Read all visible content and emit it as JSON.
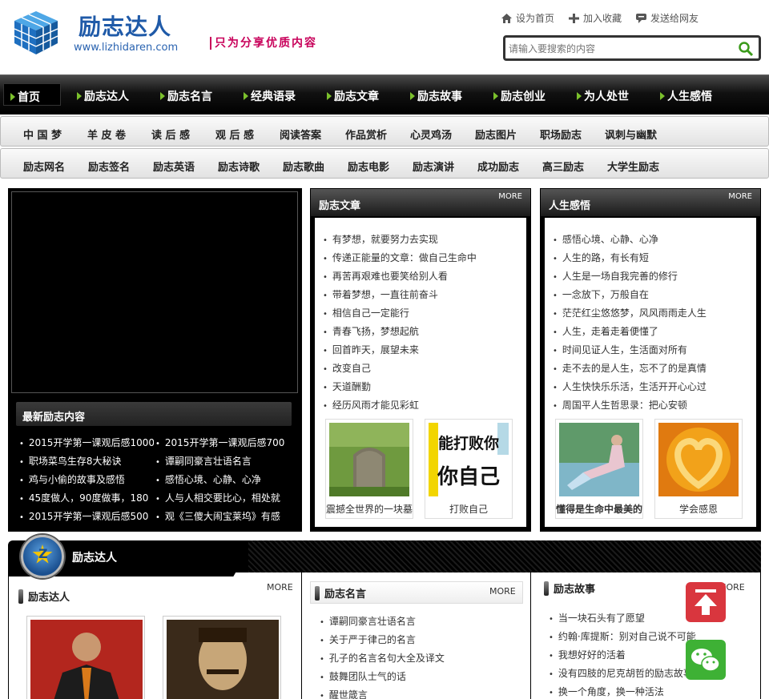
{
  "header": {
    "logo_title": "励志达人",
    "logo_url": "www.lizhidaren.com",
    "slogan": "只为分享优质内容",
    "toplinks": [
      {
        "label": "设为首页",
        "icon": "home-icon"
      },
      {
        "label": "加入收藏",
        "icon": "plus-icon"
      },
      {
        "label": "发送给网友",
        "icon": "chat-icon"
      }
    ],
    "search_placeholder": "请输入要搜索的内容"
  },
  "nav": {
    "home": "首页",
    "items": [
      "励志达人",
      "励志名言",
      "经典语录",
      "励志文章",
      "励志故事",
      "励志创业",
      "为人处世",
      "人生感悟"
    ]
  },
  "subnav1": [
    "中 国 梦",
    "羊 皮 卷",
    "读 后 感",
    "观 后 感",
    "阅读答案",
    "作品赏析",
    "心灵鸡汤",
    "励志图片",
    "职场励志",
    "讽刺与幽默"
  ],
  "subnav2": [
    "励志网名",
    "励志签名",
    "励志英语",
    "励志诗歌",
    "励志歌曲",
    "励志电影",
    "励志演讲",
    "成功励志",
    "高三励志",
    "大学生励志"
  ],
  "latest": {
    "title": "最新励志内容",
    "items": [
      "2015开学第一课观后感1000",
      "2015开学第一课观后感700",
      "职场菜鸟生存8大秘诀",
      "谭嗣同豪言壮语名言",
      "鸡与小偷的故事及感悟",
      "感悟心境、心静、心净",
      "45度做人，90度做事，180",
      "人与人相交要比心，相处就",
      "2015开学第一课观后感500",
      "观《三傻大闹宝莱坞》有感"
    ]
  },
  "articles": {
    "title": "励志文章",
    "more": "MORE",
    "items": [
      "有梦想，就要努力去实现",
      "传递正能量的文章：做自己生命中",
      "再苦再艰难也要笑给别人看",
      "带着梦想，一直往前奋斗",
      "相信自己一定能行",
      "青春飞扬，梦想起航",
      "回首昨天，展望未来",
      "改变自己",
      "天道酬勤",
      "经历风雨才能见彩虹"
    ],
    "thumbs": [
      {
        "caption": "震撼全世界的一块墓"
      },
      {
        "caption": "打败自己",
        "img_text": "能打败你 你自己"
      }
    ]
  },
  "life": {
    "title": "人生感悟",
    "more": "MORE",
    "items": [
      "感悟心境、心静、心净",
      "人生的路，有长有短",
      "人生是一场自我完善的修行",
      "一念放下，万般自在",
      "茫茫红尘悠悠梦，风风雨雨走人生",
      "人生，走着走着便懂了",
      "时间见证人生，生活面对所有",
      "走不去的是人生，忘不了的是真情",
      "人生快快乐乐活，生活开开心心过",
      "周国平人生哲思录：把心安顿"
    ],
    "thumbs": [
      {
        "caption": "懂得是生命中最美的"
      },
      {
        "caption": "学会感恩"
      }
    ]
  },
  "bottom": {
    "title": "励志达人",
    "col1": {
      "title": "励志达人",
      "more": "MORE"
    },
    "col2": {
      "title": "励志名言",
      "more": "MORE",
      "items": [
        "谭嗣同豪言壮语名言",
        "关于严于律己的名言",
        "孔子的名言名句大全及译文",
        "鼓舞团队士气的话",
        "醒世箴言"
      ]
    },
    "col3": {
      "title": "励志故事",
      "more": "MORE",
      "items": [
        "当一块石头有了愿望",
        "约翰·库提斯：别对自己说不可能",
        "我想好好的活着",
        "没有四肢的尼克胡哲的励志故事",
        "换一个角度，换一种活法"
      ]
    }
  },
  "colors": {
    "accent_green": "#7bc02c",
    "logo_blue": "#1f5aa8",
    "slogan_pink": "#c8005a",
    "float_red": "#d9363e",
    "float_green": "#3eb135"
  }
}
